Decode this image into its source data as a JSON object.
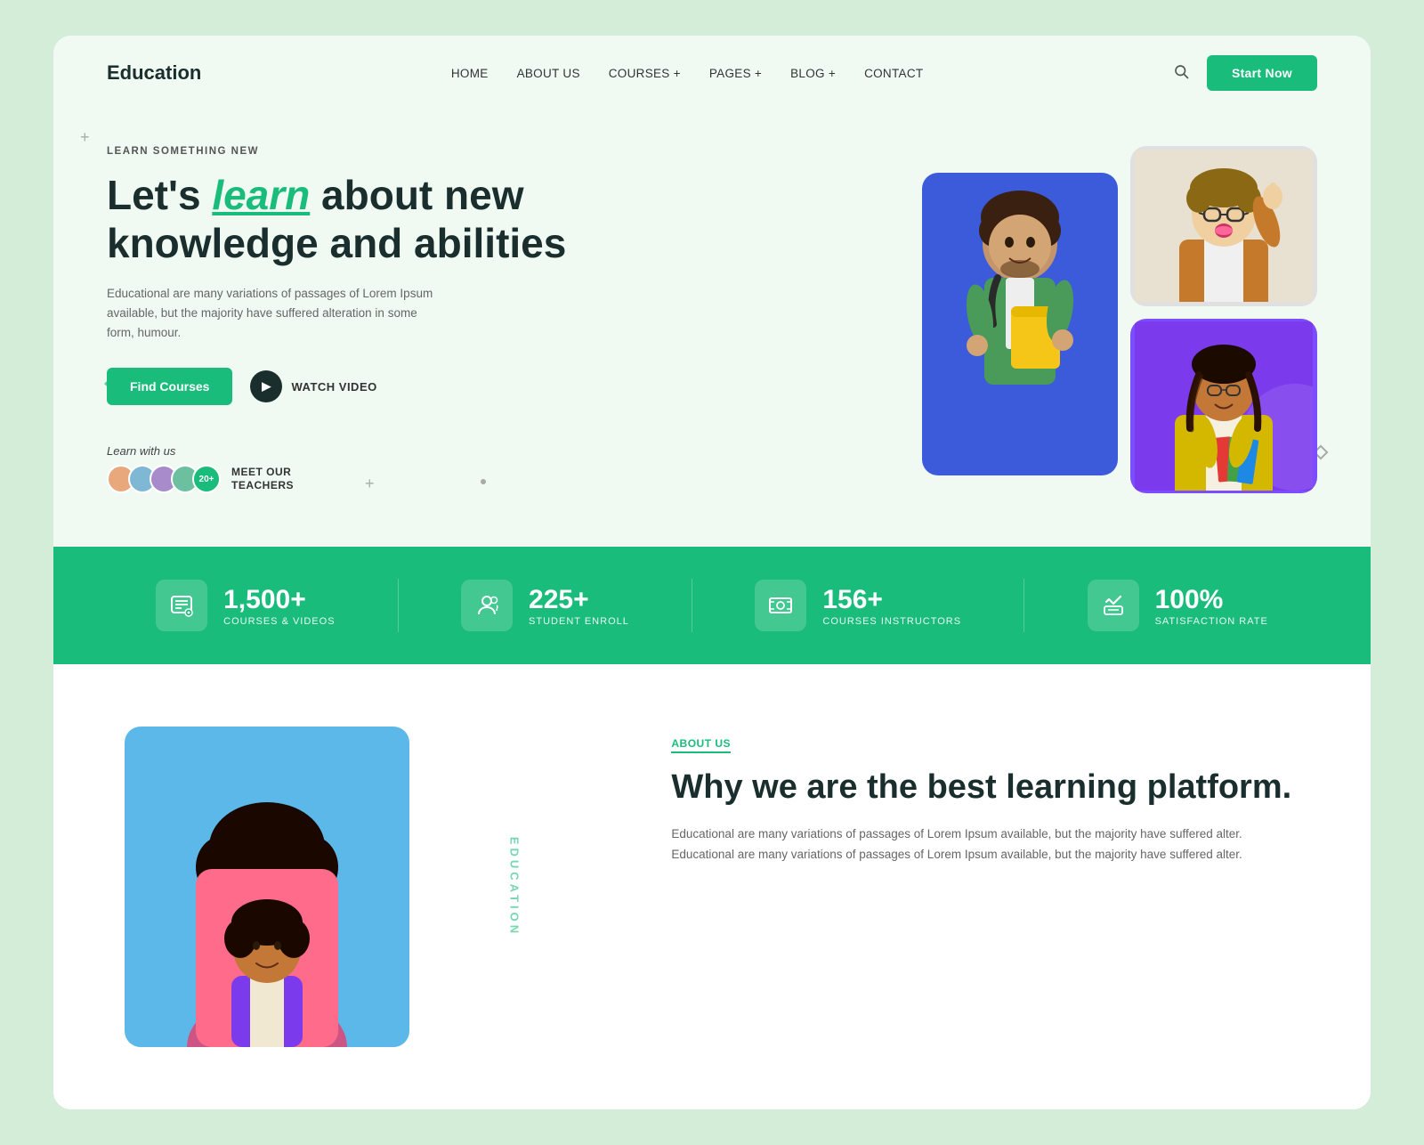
{
  "brand": {
    "logo": "Education"
  },
  "navbar": {
    "links": [
      {
        "label": "HOME",
        "id": "home"
      },
      {
        "label": "ABOUT US",
        "id": "about"
      },
      {
        "label": "COURSES +",
        "id": "courses"
      },
      {
        "label": "PAGES +",
        "id": "pages"
      },
      {
        "label": "BLOG +",
        "id": "blog"
      },
      {
        "label": "CONTACT",
        "id": "contact"
      }
    ],
    "cta": "Start Now"
  },
  "hero": {
    "eyebrow": "LEARN SOMETHING NEW",
    "title_prefix": "Let's ",
    "title_highlight": "learn",
    "title_suffix": " about new knowledge and abilities",
    "description": "Educational are many variations of passages of Lorem Ipsum available, but the majority have suffered alteration in some form, humour.",
    "find_courses_btn": "Find Courses",
    "watch_video_btn": "WATCH VIDEO",
    "learn_label": "Learn with us",
    "meet_teachers": "MEET OUR\nTEACHERS",
    "avatar_count": "20+"
  },
  "stats": [
    {
      "number": "1,500+",
      "label": "COURSES & VIDEOS",
      "icon": "📋"
    },
    {
      "number": "225+",
      "label": "STUDENT ENROLL",
      "icon": "👤"
    },
    {
      "number": "156+",
      "label": "COURSES INSTRUCTORS",
      "icon": "🎓"
    },
    {
      "number": "100%",
      "label": "SATISFACTION RATE",
      "icon": "👍"
    }
  ],
  "about": {
    "eyebrow": "ABOUT US",
    "title": "Why we are the best  learning platform.",
    "description": "Educational are many variations of passages of Lorem Ipsum available, but the majority have suffered alter. Educational are many variations of passages of Lorem Ipsum available, but the majority have suffered alter."
  }
}
